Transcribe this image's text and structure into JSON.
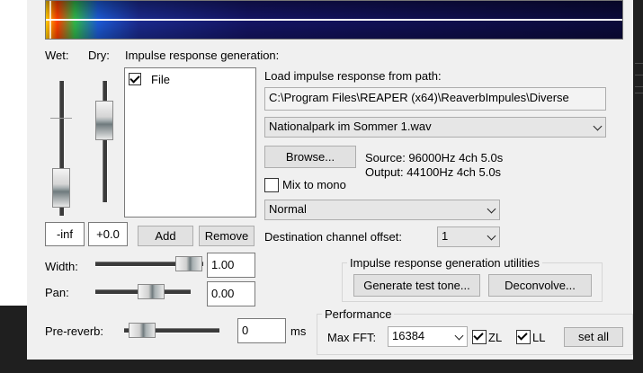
{
  "labels": {
    "wet": "Wet:",
    "dry": "Dry:",
    "ir_generation": "Impulse response generation:",
    "load_path": "Load impulse response from path:",
    "source": "Source: 96000Hz 4ch 5.0s",
    "output": "Output: 44100Hz 4ch 5.0s",
    "mix_to_mono": "Mix to mono",
    "destination_offset": "Destination channel offset:",
    "width": "Width:",
    "pan": "Pan:",
    "pre_reverb": "Pre-reverb:",
    "ms": "ms",
    "ir_utilities": "Impulse response generation utilities",
    "performance": "Performance",
    "max_fft": "Max FFT:",
    "zl": "ZL",
    "ll": "LL"
  },
  "ir_list": {
    "items": [
      {
        "label": "File",
        "checked": true
      }
    ]
  },
  "fields": {
    "wet_value": "-inf",
    "dry_value": "+0.0",
    "path_value": "C:\\Program Files\\REAPER (x64)\\ReaverbImpules\\Diverse",
    "file_selected": "Nationalpark im Sommer 1.wav",
    "mode_selected": "Normal",
    "offset_selected": "1",
    "width_value": "1.00",
    "pan_value": "0.00",
    "pre_reverb_value": "0",
    "max_fft_selected": "16384"
  },
  "buttons": {
    "add": "Add",
    "remove": "Remove",
    "browse": "Browse...",
    "generate": "Generate test tone...",
    "deconvolve": "Deconvolve...",
    "set_all": "set all"
  },
  "checkboxes": {
    "mix_to_mono": false,
    "zl": true,
    "ll": true
  },
  "slider_levels": {
    "wet": 0.0,
    "dry": 0.85,
    "width": 1.0,
    "pan": 0.5,
    "pre_reverb": 0.0
  },
  "colors": {
    "panel_bg": "#f0f0f0",
    "spectrogram_bg": "#0b0a3a",
    "track": "#3b3b3b"
  }
}
